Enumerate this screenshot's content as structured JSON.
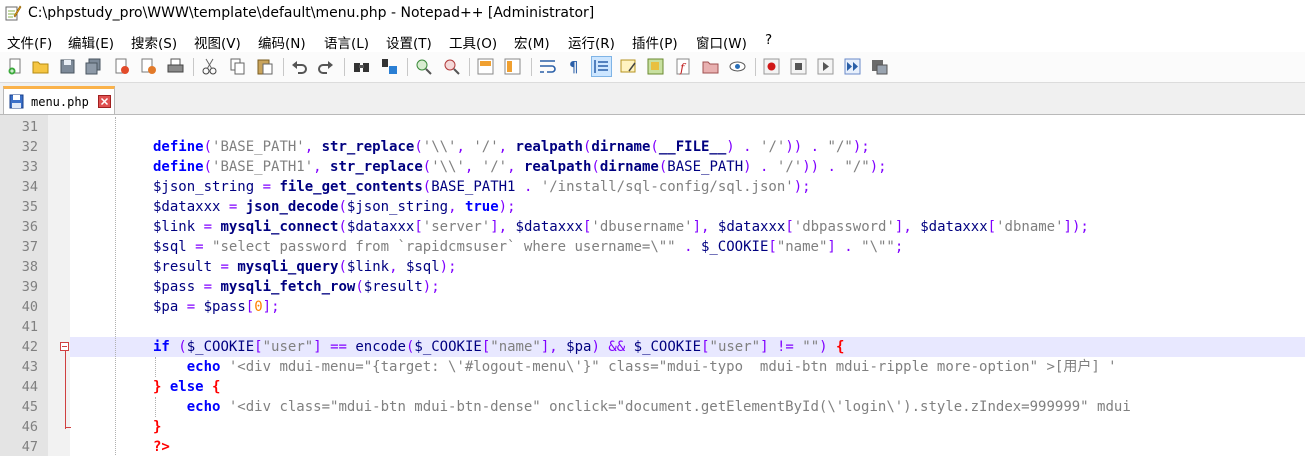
{
  "window": {
    "title": "C:\\phpstudy_pro\\WWW\\template\\default\\menu.php - Notepad++ [Administrator]"
  },
  "menu": [
    "文件(F)",
    "编辑(E)",
    "搜索(S)",
    "视图(V)",
    "编码(N)",
    "语言(L)",
    "设置(T)",
    "工具(O)",
    "宏(M)",
    "运行(R)",
    "插件(P)",
    "窗口(W)",
    "?"
  ],
  "toolbar_icons": [
    "new-file-icon",
    "open-file-icon",
    "save-icon",
    "save-all-icon",
    "close-icon",
    "close-all-icon",
    "print-icon",
    "cut-icon",
    "copy-icon",
    "paste-icon",
    "undo-icon",
    "redo-icon",
    "find-icon",
    "replace-icon",
    "zoom-in-icon",
    "zoom-out-icon",
    "sync-vertical-icon",
    "sync-horizontal-icon",
    "word-wrap-icon",
    "show-all-chars-icon",
    "indent-guide-icon",
    "udl-icon",
    "doc-map-icon",
    "function-list-icon",
    "folder-workspace-icon",
    "monitoring-icon",
    "record-macro-icon",
    "stop-record-icon",
    "play-macro-icon",
    "run-macro-multiple-icon",
    "save-macro-icon"
  ],
  "tab": {
    "label": "menu.php"
  },
  "editor": {
    "current_line": 42,
    "lines": [
      {
        "n": "31",
        "t": ""
      },
      {
        "n": "32",
        "t": "define('BASE_PATH', str_replace('\\\\', '/', realpath(dirname(__FILE__) . '/')) . \"/\");"
      },
      {
        "n": "33",
        "t": "define('BASE_PATH1', str_replace('\\\\', '/', realpath(dirname(BASE_PATH) . '/')) . \"/\");"
      },
      {
        "n": "34",
        "t": "$json_string = file_get_contents(BASE_PATH1 . '/install/sql-config/sql.json');"
      },
      {
        "n": "35",
        "t": "$dataxxx = json_decode($json_string, true);"
      },
      {
        "n": "36",
        "t": "$link = mysqli_connect($dataxxx['server'], $dataxxx['dbusername'], $dataxxx['dbpassword'], $dataxxx['dbname']);"
      },
      {
        "n": "37",
        "t": "$sql = \"select password from `rapidcmsuser` where username=\\\"\" . $_COOKIE[\"name\"] . \"\\\"\";"
      },
      {
        "n": "38",
        "t": "$result = mysqli_query($link, $sql);"
      },
      {
        "n": "39",
        "t": "$pass = mysqli_fetch_row($result);"
      },
      {
        "n": "40",
        "t": "$pa = $pass[0];"
      },
      {
        "n": "41",
        "t": ""
      },
      {
        "n": "42",
        "t": "if ($_COOKIE[\"user\"] == encode($_COOKIE[\"name\"], $pa) && $_COOKIE[\"user\"] != \"\") {"
      },
      {
        "n": "43",
        "t": "    echo '<div mdui-menu=\"{target: \\'#logout-menu\\'}\" class=\"mdui-typo  mdui-btn mdui-ripple more-option\" >[用户] '"
      },
      {
        "n": "44",
        "t": "} else {"
      },
      {
        "n": "45",
        "t": "    echo '<div class=\"mdui-btn mdui-btn-dense\" onclick=\"document.getElementById(\\'login\\').style.zIndex=999999\" mdui"
      },
      {
        "n": "46",
        "t": "}"
      },
      {
        "n": "47",
        "t": "?>"
      }
    ]
  }
}
